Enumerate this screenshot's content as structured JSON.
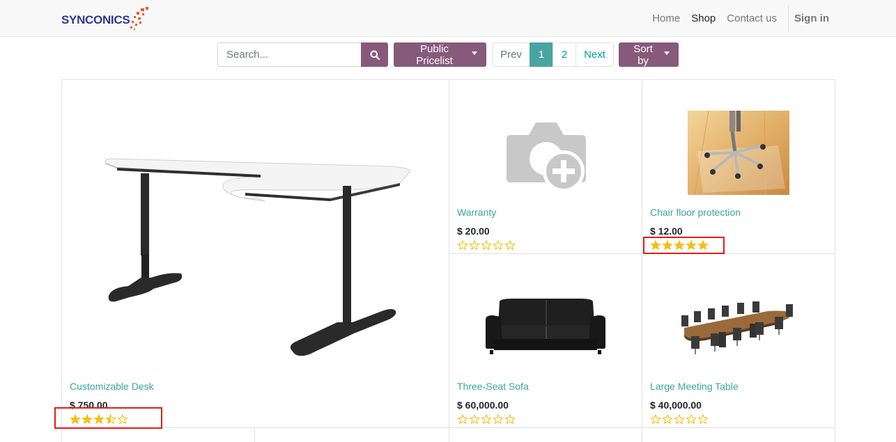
{
  "brand": {
    "name": "SYNCONICS"
  },
  "nav": {
    "items": [
      {
        "label": "Home",
        "active": false
      },
      {
        "label": "Shop",
        "active": true
      },
      {
        "label": "Contact us",
        "active": false
      }
    ],
    "sign_in": "Sign in"
  },
  "search": {
    "placeholder": "Search...",
    "value": ""
  },
  "pricelist": {
    "label": "Public Pricelist"
  },
  "pager": {
    "prev": "Prev",
    "pages": [
      "1",
      "2"
    ],
    "current": "1",
    "next": "Next"
  },
  "sort": {
    "label": "Sort by"
  },
  "colors": {
    "primary": "#875a7b",
    "link": "#3aa3a0",
    "active_page": "#48a5a1",
    "star": "#f3c019",
    "highlight": "#e31b1b"
  },
  "products": [
    {
      "name": "Customizable Desk",
      "price": "$ 750.00",
      "rating": 3.5,
      "image": "desk-image",
      "highlighted": true
    },
    {
      "name": "Warranty",
      "price": "$ 20.00",
      "rating": 0,
      "image": "placeholder-camera-icon",
      "highlighted": false
    },
    {
      "name": "Chair floor protection",
      "price": "$ 12.00",
      "rating": 5,
      "image": "chair-floor-image",
      "highlighted": true
    },
    {
      "name": "Three-Seat Sofa",
      "price": "$ 60,000.00",
      "rating": 0,
      "image": "sofa-image",
      "highlighted": false
    },
    {
      "name": "Large Meeting Table",
      "price": "$ 40,000.00",
      "rating": 0,
      "image": "meeting-table-image",
      "highlighted": false
    }
  ]
}
